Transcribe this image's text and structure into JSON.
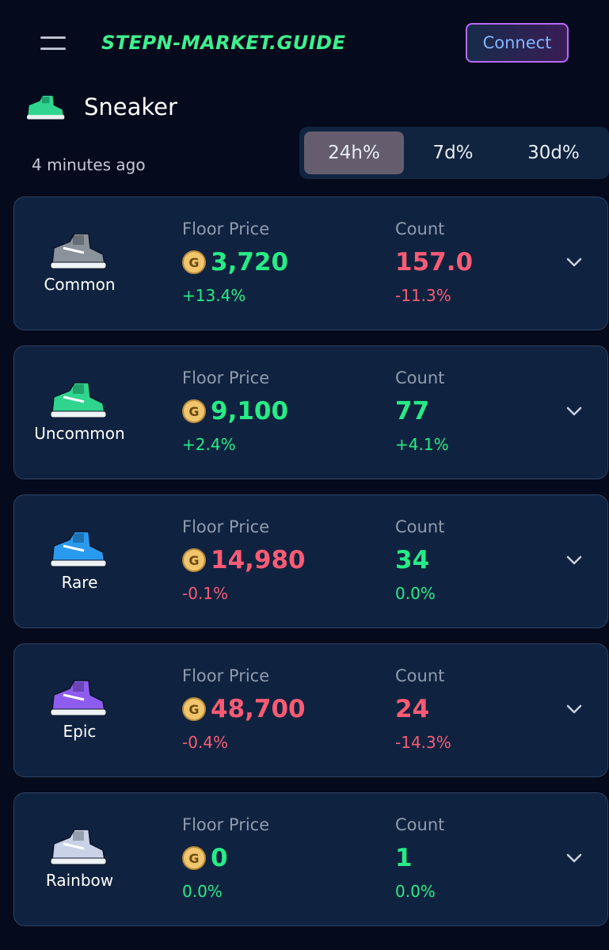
{
  "header": {
    "logo": "STEPN-MARKET.GUIDE",
    "connect_label": "Connect"
  },
  "section": {
    "title": "Sneaker",
    "updated": "4 minutes ago"
  },
  "period_tabs": [
    {
      "label": "24h%",
      "active": true
    },
    {
      "label": "7d%",
      "active": false
    },
    {
      "label": "30d%",
      "active": false
    }
  ],
  "colors": {
    "up": "#27ec85",
    "down": "#fb5b74",
    "accent": "#3ff08e",
    "card_bg": "#0f2340",
    "page_bg": "#050a1c"
  },
  "cards": [
    {
      "rarity": "Common",
      "shoe_color": "#8a929b",
      "floor_label": "Floor Price",
      "floor": "3,720",
      "floor_dir": "up",
      "floor_change": "+13.4%",
      "floor_change_dir": "up",
      "count_label": "Count",
      "count": "157.0",
      "count_dir": "down",
      "count_change": "-11.3%",
      "count_change_dir": "down"
    },
    {
      "rarity": "Uncommon",
      "shoe_color": "#2fd58e",
      "floor_label": "Floor Price",
      "floor": "9,100",
      "floor_dir": "up",
      "floor_change": "+2.4%",
      "floor_change_dir": "up",
      "count_label": "Count",
      "count": "77",
      "count_dir": "up",
      "count_change": "+4.1%",
      "count_change_dir": "up"
    },
    {
      "rarity": "Rare",
      "shoe_color": "#2a9af0",
      "floor_label": "Floor Price",
      "floor": "14,980",
      "floor_dir": "down",
      "floor_change": "-0.1%",
      "floor_change_dir": "down",
      "count_label": "Count",
      "count": "34",
      "count_dir": "up",
      "count_change": "0.0%",
      "count_change_dir": "up"
    },
    {
      "rarity": "Epic",
      "shoe_color": "#8f5cf0",
      "floor_label": "Floor Price",
      "floor": "48,700",
      "floor_dir": "down",
      "floor_change": "-0.4%",
      "floor_change_dir": "down",
      "count_label": "Count",
      "count": "24",
      "count_dir": "down",
      "count_change": "-14.3%",
      "count_change_dir": "down"
    },
    {
      "rarity": "Rainbow",
      "shoe_color": "#c9d2e6",
      "floor_label": "Floor Price",
      "floor": "0",
      "floor_dir": "up",
      "floor_change": "0.0%",
      "floor_change_dir": "up",
      "count_label": "Count",
      "count": "1",
      "count_dir": "up",
      "count_change": "0.0%",
      "count_change_dir": "up"
    }
  ]
}
